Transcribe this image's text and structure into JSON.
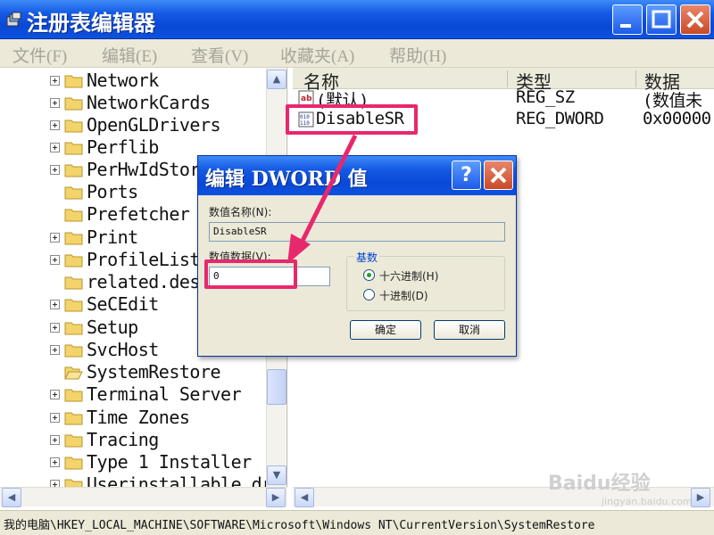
{
  "window": {
    "title": "注册表编辑器",
    "colors": {
      "titlebar": "#0a48d6",
      "highlight": "#e8286c",
      "dialog_bg": "#ece9d8"
    }
  },
  "menu": [
    "文件(F)",
    "编辑(E)",
    "查看(V)",
    "收藏夹(A)",
    "帮助(H)"
  ],
  "tree": [
    {
      "label": "Network",
      "expandable": true
    },
    {
      "label": "NetworkCards",
      "expandable": true
    },
    {
      "label": "OpenGLDrivers",
      "expandable": true
    },
    {
      "label": "Perflib",
      "expandable": true
    },
    {
      "label": "PerHwIdStor",
      "expandable": true
    },
    {
      "label": "Ports",
      "expandable": false
    },
    {
      "label": "Prefetcher",
      "expandable": false
    },
    {
      "label": "Print",
      "expandable": true
    },
    {
      "label": "ProfileList",
      "expandable": true
    },
    {
      "label": "related.des",
      "expandable": false
    },
    {
      "label": "SeCEdit",
      "expandable": true
    },
    {
      "label": "Setup",
      "expandable": true
    },
    {
      "label": "SvcHost",
      "expandable": true
    },
    {
      "label": "SystemRestore",
      "expandable": false
    },
    {
      "label": "Terminal Server",
      "expandable": true
    },
    {
      "label": "Time Zones",
      "expandable": true
    },
    {
      "label": "Tracing",
      "expandable": true
    },
    {
      "label": "Type 1 Installer",
      "expandable": true
    },
    {
      "label": "Userinstallable.dr",
      "expandable": true
    }
  ],
  "list": {
    "columns": [
      "名称",
      "类型",
      "数据"
    ],
    "rows": [
      {
        "name": "(默认)",
        "type": "REG_SZ",
        "data": "(数值未",
        "icon": "string-value-icon"
      },
      {
        "name": "DisableSR",
        "type": "REG_DWORD",
        "data": "0x00000",
        "icon": "dword-value-icon"
      }
    ]
  },
  "statusbar": "我的电脑\\HKEY_LOCAL_MACHINE\\SOFTWARE\\Microsoft\\Windows NT\\CurrentVersion\\SystemRestore",
  "dialog": {
    "title": "编辑 DWORD 值",
    "name_label": "数值名称(N):",
    "name_value": "DisableSR",
    "data_label": "数值数据(V):",
    "data_value": "0",
    "radix_label": "基数",
    "hex_label": "十六进制(H)",
    "dec_label": "十进制(D)",
    "selected_radix": "hex",
    "ok": "确定",
    "cancel": "取消"
  },
  "watermark": {
    "logo": "Baidu经验",
    "url": "jingyan.baidu.com"
  }
}
